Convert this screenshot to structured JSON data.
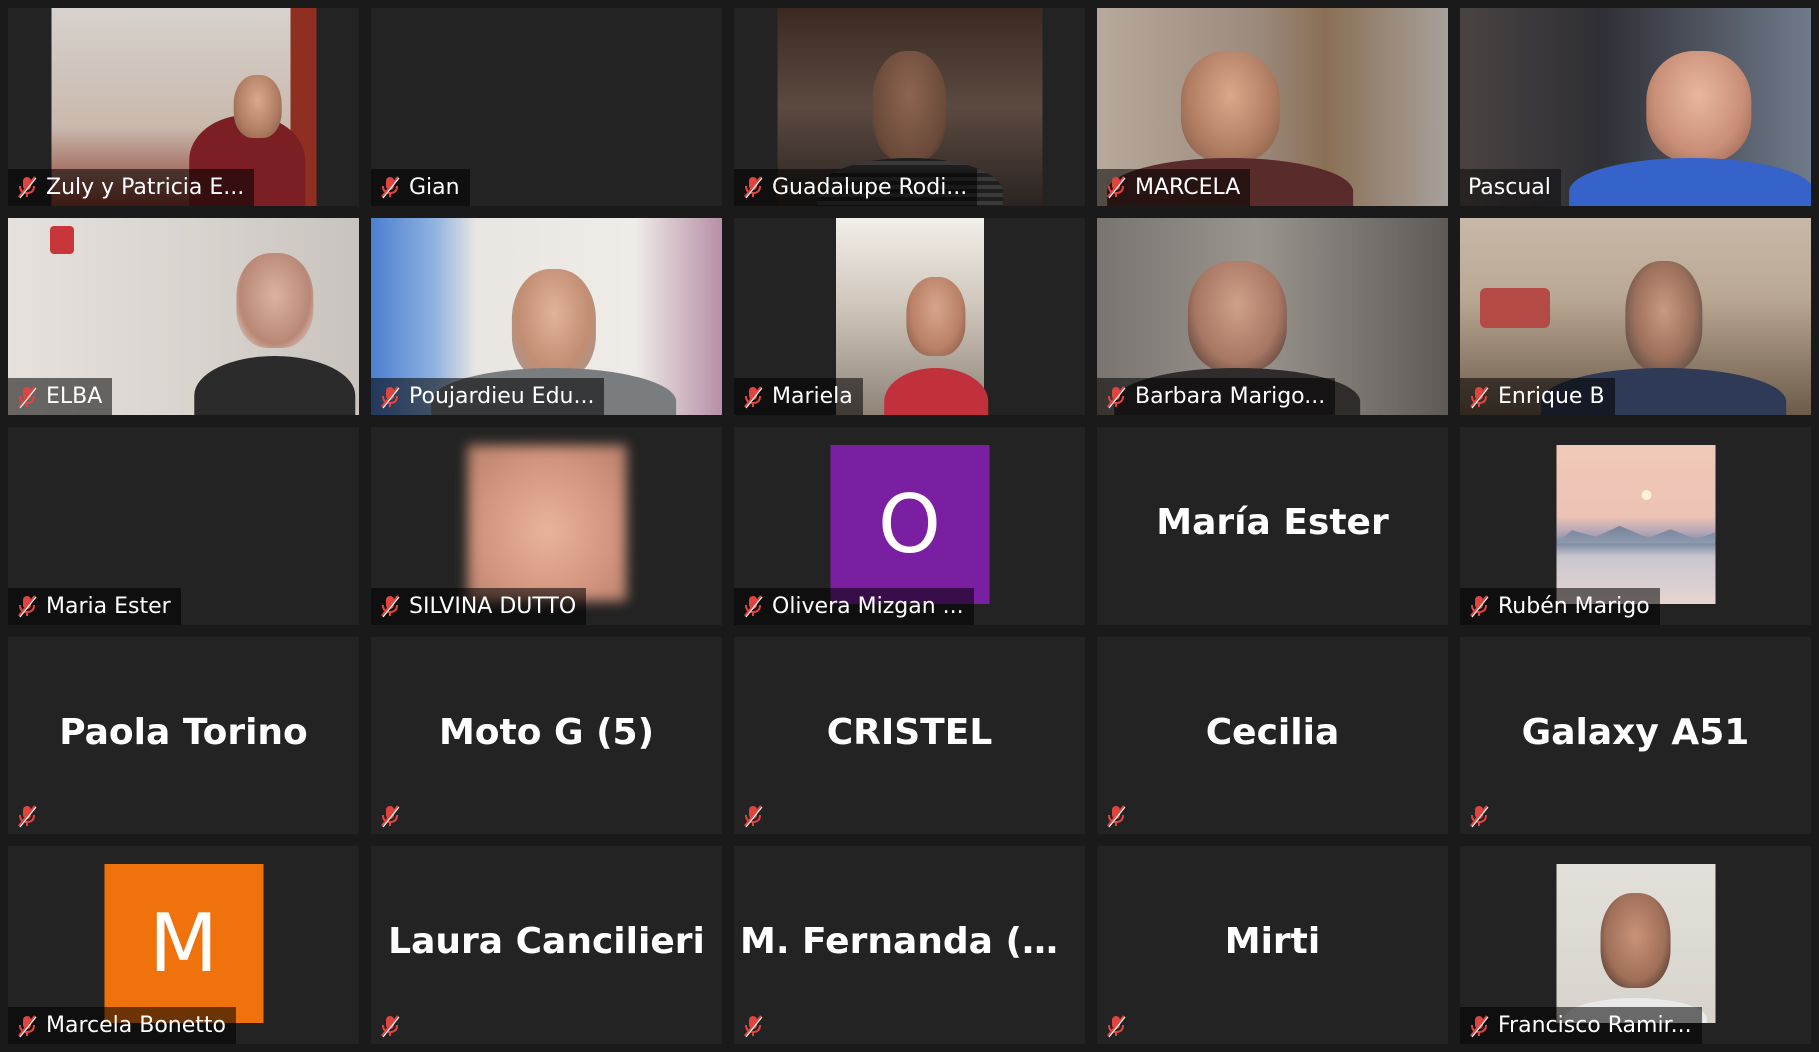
{
  "colors": {
    "background": "#1a1a1a",
    "tile": "#232323",
    "mic_muted": "#e0443f",
    "avatar_purple": "#7b1fa2",
    "avatar_orange": "#f0720d"
  },
  "participants": [
    {
      "name": "Zuly y Patricia E...",
      "view": "video",
      "muted": true
    },
    {
      "name": "Gian",
      "view": "empty",
      "muted": true
    },
    {
      "name": "Guadalupe Rodi...",
      "view": "video",
      "muted": true
    },
    {
      "name": "MARCELA",
      "view": "video",
      "muted": true
    },
    {
      "name": "Pascual",
      "view": "video",
      "muted": false
    },
    {
      "name": "ELBA",
      "view": "video",
      "muted": true
    },
    {
      "name": "Poujardieu Edu...",
      "view": "video",
      "muted": true
    },
    {
      "name": "Mariela",
      "view": "video",
      "muted": true
    },
    {
      "name": "Barbara Marigo...",
      "view": "video",
      "muted": true
    },
    {
      "name": "Enrique B",
      "view": "video",
      "muted": true
    },
    {
      "name": "Maria Ester",
      "view": "empty",
      "muted": true
    },
    {
      "name": "SILVINA DUTTO",
      "view": "blurred-photo",
      "muted": true
    },
    {
      "name": "Olivera Mizgan ...",
      "view": "avatar",
      "avatar_letter": "O",
      "muted": true
    },
    {
      "display_name": "María Ester",
      "view": "name-only",
      "muted": false
    },
    {
      "name": "Rubén Marigo",
      "view": "landscape-photo",
      "muted": true
    },
    {
      "display_name": "Paola Torino",
      "view": "name-only",
      "muted": true
    },
    {
      "display_name": "Moto G (5)",
      "view": "name-only",
      "muted": true
    },
    {
      "display_name": "CRISTEL",
      "view": "name-only",
      "muted": true
    },
    {
      "display_name": "Cecilia",
      "view": "name-only",
      "muted": true
    },
    {
      "display_name": "Galaxy A51",
      "view": "name-only",
      "muted": true
    },
    {
      "name": "Marcela Bonetto",
      "view": "avatar",
      "avatar_letter": "M",
      "muted": true
    },
    {
      "display_name": "Laura Cancilieri",
      "view": "name-only",
      "muted": true
    },
    {
      "display_name": "M. Fernanda   (A...",
      "view": "name-only",
      "muted": true
    },
    {
      "display_name": "Mirti",
      "view": "name-only",
      "muted": true
    },
    {
      "name": "Francisco Ramir...",
      "view": "photo",
      "muted": true
    }
  ]
}
